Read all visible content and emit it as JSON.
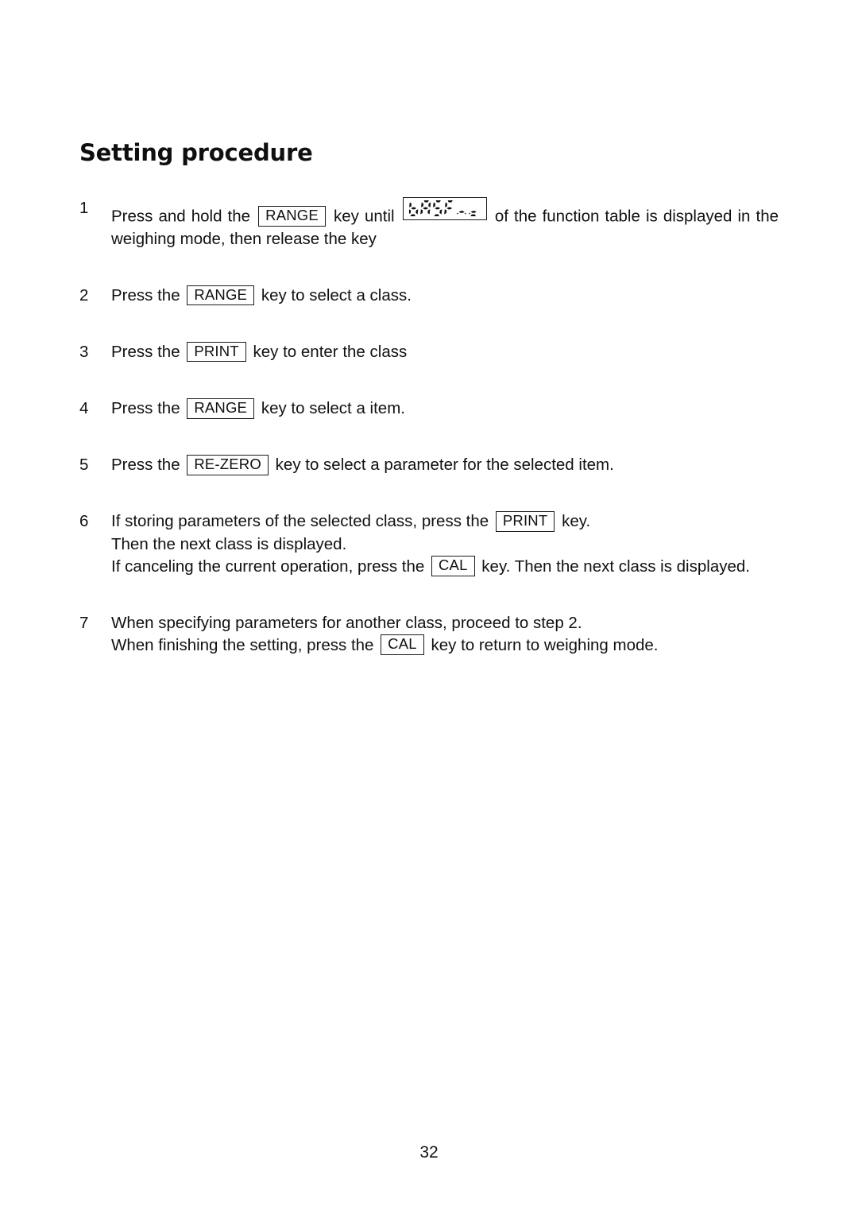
{
  "document": {
    "heading": "Setting procedure",
    "page_number": "32"
  },
  "keys": {
    "range": "RANGE",
    "print": "PRINT",
    "rezero": "RE-ZERO",
    "cal": "CAL"
  },
  "lcd": {
    "bas_fnc": "bASFnc"
  },
  "steps": [
    {
      "number": "1",
      "justify": true,
      "lines": [
        {
          "segments": [
            {
              "type": "text",
              "value": "Press and hold the"
            },
            {
              "type": "key",
              "value": "RANGE"
            },
            {
              "type": "text",
              "value": "key until"
            },
            {
              "type": "lcd",
              "value": "bASFnc"
            },
            {
              "type": "text",
              "value": "of the function table is displayed in the weighing mode, then release the key"
            }
          ]
        }
      ]
    },
    {
      "number": "2",
      "justify": false,
      "lines": [
        {
          "segments": [
            {
              "type": "text",
              "value": "Press the"
            },
            {
              "type": "key",
              "value": "RANGE"
            },
            {
              "type": "text",
              "value": "key to select a class."
            }
          ]
        }
      ]
    },
    {
      "number": "3",
      "justify": false,
      "lines": [
        {
          "segments": [
            {
              "type": "text",
              "value": "Press the"
            },
            {
              "type": "key",
              "value": "PRINT"
            },
            {
              "type": "text",
              "value": "key to enter the class"
            }
          ]
        }
      ]
    },
    {
      "number": "4",
      "justify": false,
      "lines": [
        {
          "segments": [
            {
              "type": "text",
              "value": "Press the"
            },
            {
              "type": "key",
              "value": "RANGE"
            },
            {
              "type": "text",
              "value": "key to select a item."
            }
          ]
        }
      ]
    },
    {
      "number": "5",
      "justify": false,
      "lines": [
        {
          "segments": [
            {
              "type": "text",
              "value": "Press the"
            },
            {
              "type": "key",
              "value": "RE-ZERO"
            },
            {
              "type": "text",
              "value": "key to select a parameter for the selected item."
            }
          ]
        }
      ]
    },
    {
      "number": "6",
      "justify": false,
      "lines": [
        {
          "segments": [
            {
              "type": "text",
              "value": "If storing parameters of the selected class, press the"
            },
            {
              "type": "key",
              "value": "PRINT"
            },
            {
              "type": "text",
              "value": "key."
            }
          ]
        },
        {
          "segments": [
            {
              "type": "text",
              "value": "Then the next class is displayed."
            }
          ]
        },
        {
          "segments": [
            {
              "type": "text",
              "value": "If canceling the current operation, press the"
            },
            {
              "type": "key",
              "value": "CAL"
            },
            {
              "type": "text",
              "value": "key. Then the next class is displayed."
            }
          ]
        }
      ]
    },
    {
      "number": "7",
      "justify": false,
      "lines": [
        {
          "segments": [
            {
              "type": "text",
              "value": "When specifying parameters for another class, proceed to step 2."
            }
          ]
        },
        {
          "segments": [
            {
              "type": "text",
              "value": "When finishing the setting, press the"
            },
            {
              "type": "key",
              "value": "CAL"
            },
            {
              "type": "text",
              "value": "key to return to weighing mode."
            }
          ]
        }
      ]
    }
  ]
}
